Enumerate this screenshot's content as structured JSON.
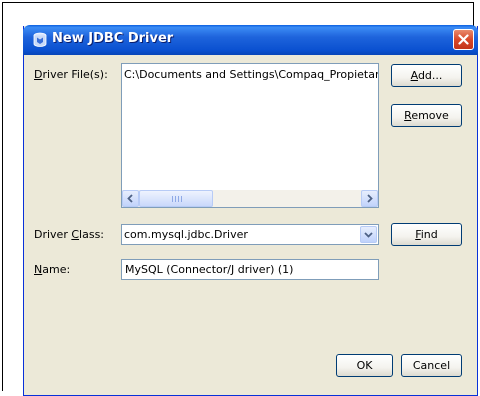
{
  "dialog": {
    "title": "New JDBC Driver"
  },
  "driver_files": {
    "label_prefix": "",
    "label_mnemonic": "D",
    "label_rest": "river File(s):",
    "items": [
      "C:\\Documents and Settings\\Compaq_Propietario\\Mis Documentos"
    ],
    "add_button": {
      "mnemonic": "A",
      "rest": "dd..."
    },
    "remove_button": {
      "mnemonic": "R",
      "rest": "emove"
    }
  },
  "driver_class": {
    "label_prefix": "Driver ",
    "label_mnemonic": "C",
    "label_rest": "lass:",
    "value": "com.mysql.jdbc.Driver",
    "find_button": {
      "mnemonic": "F",
      "rest": "ind"
    }
  },
  "name": {
    "label_mnemonic": "N",
    "label_rest": "ame:",
    "value": "MySQL (Connector/J driver) (1)"
  },
  "footer": {
    "ok_label": "OK",
    "cancel_label": "Cancel"
  },
  "icons": [
    "jdbc-driver-icon",
    "close-icon",
    "scroll-left-icon",
    "scroll-right-icon",
    "dropdown-arrow-icon"
  ]
}
